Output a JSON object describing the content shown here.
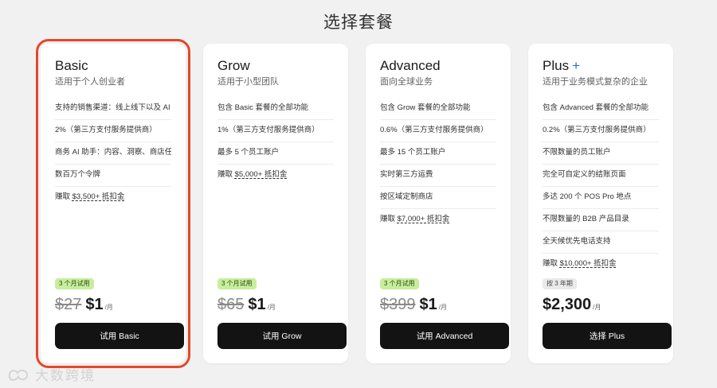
{
  "page_title": "选择套餐",
  "plans": [
    {
      "name": "Basic",
      "plus_mark": "",
      "subtitle": "适用于个人创业者",
      "features": [
        {
          "text": "支持的销售渠道：线上线下以及 AI 聊天",
          "link": ""
        },
        {
          "text": "2%（第三方支付服务提供商）",
          "link": ""
        },
        {
          "text": "商务 AI 助手：内容、洞察、商店任务等",
          "link": ""
        },
        {
          "text": "数百万个令牌",
          "link": ""
        },
        {
          "text": "赚取 ",
          "link": "$3,500+ 抵扣金"
        }
      ],
      "badge": "3 个月试用",
      "old_price": "$27",
      "new_price": "$1",
      "per": "/月",
      "cta": "试用 Basic"
    },
    {
      "name": "Grow",
      "plus_mark": "",
      "subtitle": "适用于小型团队",
      "features": [
        {
          "text": "包含 Basic 套餐的全部功能",
          "link": ""
        },
        {
          "text": "1%（第三方支付服务提供商）",
          "link": ""
        },
        {
          "text": "最多 5 个员工账户",
          "link": ""
        },
        {
          "text": "赚取 ",
          "link": "$5,000+ 抵扣金"
        }
      ],
      "badge": "3 个月试用",
      "old_price": "$65",
      "new_price": "$1",
      "per": "/月",
      "cta": "试用 Grow"
    },
    {
      "name": "Advanced",
      "plus_mark": "",
      "subtitle": "面向全球业务",
      "features": [
        {
          "text": "包含 Grow 套餐的全部功能",
          "link": ""
        },
        {
          "text": "0.6%（第三方支付服务提供商）",
          "link": ""
        },
        {
          "text": "最多 15 个员工账户",
          "link": ""
        },
        {
          "text": "实时第三方运费",
          "link": ""
        },
        {
          "text": "按区域定制商店",
          "link": ""
        },
        {
          "text": "赚取 ",
          "link": "$7,000+ 抵扣金"
        }
      ],
      "badge": "3 个月试用",
      "old_price": "$399",
      "new_price": "$1",
      "per": "/月",
      "cta": "试用 Advanced"
    },
    {
      "name": "Plus",
      "plus_mark": "+",
      "subtitle": "适用于业务模式复杂的企业",
      "features": [
        {
          "text": "包含 Advanced 套餐的全部功能",
          "link": ""
        },
        {
          "text": "0.2%（第三方支付服务提供商）",
          "link": ""
        },
        {
          "text": "不限数量的员工账户",
          "link": ""
        },
        {
          "text": "完全可自定义的结账页面",
          "link": ""
        },
        {
          "text": "多达 200 个 POS Pro 地点",
          "link": ""
        },
        {
          "text": "不限数量的 B2B 产品目录",
          "link": ""
        },
        {
          "text": "全天候优先电话支持",
          "link": ""
        },
        {
          "text": "赚取 ",
          "link": "$10,000+ 抵扣金"
        }
      ],
      "badge": "按 3 年期",
      "old_price": "",
      "new_price": "$2,300",
      "per": "/月",
      "cta": "选择 Plus"
    }
  ],
  "watermark": "大数跨境",
  "colors": {
    "highlight_border": "#e5472b",
    "trial_badge": "#c8ed9c",
    "term_badge": "#eaeaea",
    "button": "#131313",
    "plus_accent": "#2c6ecb"
  }
}
